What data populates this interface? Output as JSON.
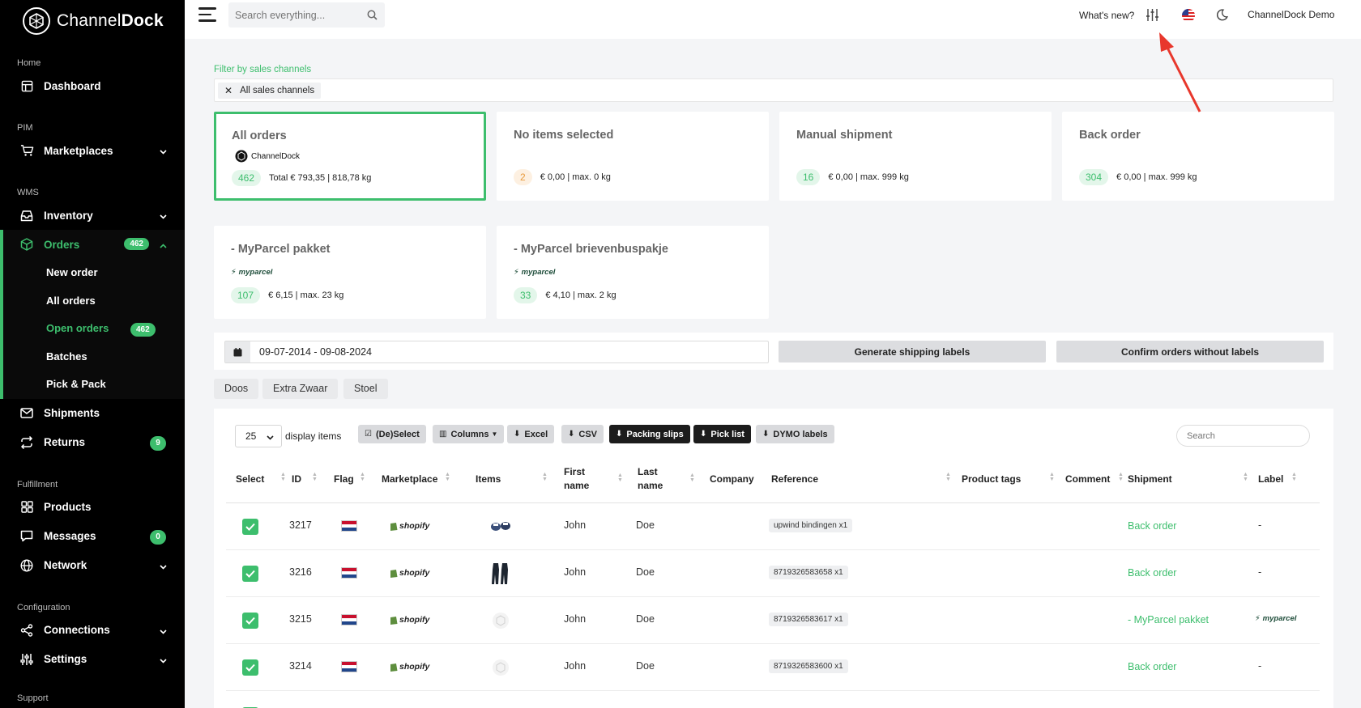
{
  "app": {
    "name_light": "Channel",
    "name_bold": "Dock"
  },
  "sidebar": {
    "sections": {
      "home": "Home",
      "pim": "PIM",
      "wms": "WMS",
      "fulfillment": "Fulfillment",
      "configuration": "Configuration",
      "support": "Support"
    },
    "items": {
      "dashboard": "Dashboard",
      "marketplaces": "Marketplaces",
      "inventory": "Inventory",
      "orders": "Orders",
      "orders_badge": "462",
      "shipments": "Shipments",
      "returns": "Returns",
      "returns_badge": "9",
      "products": "Products",
      "messages": "Messages",
      "messages_badge": "0",
      "network": "Network",
      "connections": "Connections",
      "settings": "Settings"
    },
    "orders_sub": {
      "new_order": "New order",
      "all_orders": "All orders",
      "open_orders": "Open orders",
      "open_orders_badge": "462",
      "batches": "Batches",
      "pick_pack": "Pick & Pack"
    }
  },
  "topbar": {
    "search_placeholder": "Search everything...",
    "whats_new": "What's new?",
    "account": "ChannelDock Demo"
  },
  "filter": {
    "label": "Filter by sales channels",
    "chip": "All sales channels"
  },
  "cards": [
    {
      "title": "All orders",
      "brand": "ChannelDock",
      "count": "462",
      "text": "Total € 793,35 | 818,78 kg"
    },
    {
      "title": "No items selected",
      "count": "2",
      "text": "€ 0,00 | max. 0 kg"
    },
    {
      "title": "Manual shipment",
      "count": "16",
      "text": "€ 0,00 | max. 999 kg"
    },
    {
      "title": "Back order",
      "count": "304",
      "text": "€ 0,00 | max. 999 kg"
    },
    {
      "title": "- MyParcel pakket",
      "brand": "myparcel",
      "count": "107",
      "text": "€ 6,15 | max. 23 kg"
    },
    {
      "title": "- MyParcel brievenbuspakje",
      "brand": "myparcel",
      "count": "33",
      "text": "€ 4,10 | max. 2 kg"
    }
  ],
  "actions": {
    "date_range": "09-07-2014 - 09-08-2024",
    "generate": "Generate shipping labels",
    "confirm": "Confirm orders without labels"
  },
  "tags": [
    "Doos",
    "Extra Zwaar",
    "Stoel"
  ],
  "table": {
    "per_page": "25",
    "display_items": "display items",
    "buttons": {
      "deselect": "(De)Select",
      "columns": "Columns",
      "excel": "Excel",
      "csv": "CSV",
      "packing_slips": "Packing slips",
      "pick_list": "Pick list",
      "dymo": "DYMO labels"
    },
    "search_placeholder": "Search",
    "headers": {
      "select": "Select",
      "id": "ID",
      "flag": "Flag",
      "marketplace": "Marketplace",
      "items": "Items",
      "first_1": "First",
      "first_2": "name",
      "last_1": "Last",
      "last_2": "name",
      "company": "Company",
      "reference": "Reference",
      "product_tags": "Product tags",
      "comment": "Comment",
      "shipment": "Shipment",
      "label": "Label"
    },
    "marketplace_name": "shopify",
    "rows": [
      {
        "id": "3217",
        "first": "John",
        "last": "Doe",
        "reference": "upwind bindingen x1",
        "shipment": "Back order",
        "label": "-"
      },
      {
        "id": "3216",
        "first": "John",
        "last": "Doe",
        "reference": "8719326583658 x1",
        "shipment": "Back order",
        "label": "-"
      },
      {
        "id": "3215",
        "first": "John",
        "last": "Doe",
        "reference": "8719326583617 x1",
        "shipment": "- MyParcel pakket",
        "label": "myparcel"
      },
      {
        "id": "3214",
        "first": "John",
        "last": "Doe",
        "reference": "8719326583600 x1",
        "shipment": "Back order",
        "label": "-"
      }
    ]
  },
  "colors": {
    "accent": "#3dbe6d",
    "sidebar": "#000000",
    "annotation_arrow": "#e8372c"
  }
}
